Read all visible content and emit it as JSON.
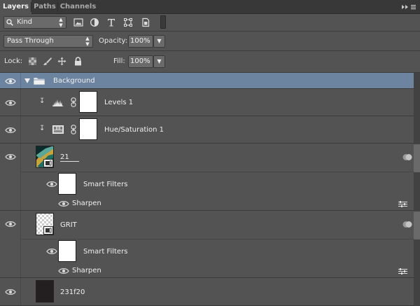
{
  "tabs": [
    {
      "label": "Layers",
      "active": true
    },
    {
      "label": "Paths",
      "active": false
    },
    {
      "label": "Channels",
      "active": false
    }
  ],
  "panel_menu_icon": "double-chevron-menu-icon",
  "filter": {
    "kind_label": "Kind",
    "icons": [
      "pixel-filter-icon",
      "adjustment-filter-icon",
      "type-filter-icon",
      "shape-filter-icon",
      "smart-object-filter-icon"
    ]
  },
  "blend": {
    "mode": "Pass Through",
    "opacity_label": "Opacity:",
    "opacity_value": "100%"
  },
  "lock": {
    "label": "Lock:",
    "fill_label": "Fill:",
    "fill_value": "100%"
  },
  "layers": [
    {
      "name": "Background",
      "type": "group",
      "selected": true
    },
    {
      "name": "Levels 1",
      "type": "adjustment",
      "clipped": true
    },
    {
      "name": "Hue/Saturation 1",
      "type": "adjustment",
      "clipped": true
    },
    {
      "name": "21",
      "type": "smart-object",
      "filters_label": "Smart Filters",
      "filter_name": "Sharpen"
    },
    {
      "name": "GRIT",
      "type": "smart-object",
      "filters_label": "Smart Filters",
      "filter_name": "Sharpen"
    },
    {
      "name": "231f20",
      "type": "pixel"
    }
  ],
  "colors": {
    "panel_bg": "#535353",
    "selected_row": "#6d84a0",
    "tab_bar": "#383838",
    "solid_layer": "#231f20"
  }
}
